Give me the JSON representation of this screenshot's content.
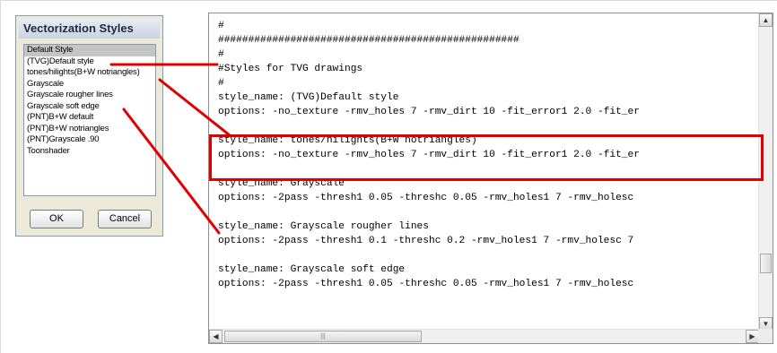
{
  "dialog": {
    "title": "Vectorization Styles",
    "styles": [
      "Default Style",
      "(TVG)Default style",
      "tones/hilights(B+W notriangles)",
      "Grayscale",
      "Grayscale rougher lines",
      "Grayscale soft edge",
      "(PNT)B+W default",
      "(PNT)B+W notriangles",
      "(PNT)Grayscale .90",
      "Toonshader"
    ],
    "selected_index": 0,
    "ok_label": "OK",
    "cancel_label": "Cancel"
  },
  "file_view": {
    "lines": [
      "#",
      "##################################################",
      "#",
      "#Styles for TVG drawings",
      "#",
      "style_name: (TVG)Default style",
      "options: -no_texture -rmv_holes 7 -rmv_dirt 10 -fit_error1 2.0 -fit_er",
      "",
      "style_name: tones/hilights(B+W notriangles)",
      "options: -no_texture -rmv_holes 7 -rmv_dirt 10 -fit_error1 2.0 -fit_er",
      "",
      "style_name: Grayscale",
      "options: -2pass -thresh1 0.05 -threshc 0.05 -rmv_holes1 7 -rmv_holesc",
      "",
      "style_name: Grayscale rougher lines",
      "options: -2pass -thresh1 0.1 -threshc 0.2 -rmv_holes1 7 -rmv_holesc 7",
      "",
      "style_name: Grayscale soft edge",
      "options: -2pass -thresh1 0.05 -threshc 0.05 -rmv_holes1 7 -rmv_holesc"
    ]
  },
  "colors": {
    "callout": "#e00000",
    "selection": "#c5c5c5",
    "dialog_bg": "#ece9d8"
  },
  "icons": {
    "scroll_up": "triangle-up-icon",
    "scroll_down": "triangle-down-icon",
    "scroll_left": "triangle-left-icon",
    "scroll_right": "triangle-right-icon"
  }
}
